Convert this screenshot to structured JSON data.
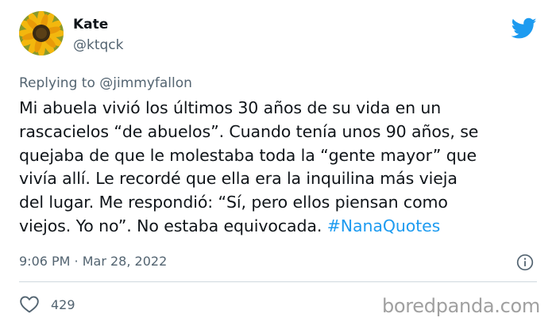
{
  "tweet": {
    "author": {
      "display_name": "Kate",
      "handle": "@ktqck",
      "avatar_icon": "sunflower-avatar"
    },
    "platform_icon": "twitter-bird-icon",
    "replying_to_prefix": "Replying to ",
    "replying_to_handle": "@jimmyfallon",
    "text": "Mi abuela vivió los últimos 30 años de su vida en un\nrascacielos “de abuelos”. Cuando tenía unos 90 años, se\nquejaba de que le molestaba toda la “gente mayor” que\nvivía allí. Le recordé que ella era la inquilina más vieja\ndel lugar. Me respondió: “Sí, pero ellos piensan como\nviejos. Yo no”. No estaba equivocada. ",
    "hashtag": "#NanaQuotes",
    "timestamp": "9:06 PM · Mar 28, 2022",
    "like_count": "429"
  },
  "watermark": "boredpanda.com",
  "colors": {
    "text": "#0f1419",
    "secondary": "#536471",
    "accent": "#1d9bf0",
    "divider": "#cfd9de"
  }
}
